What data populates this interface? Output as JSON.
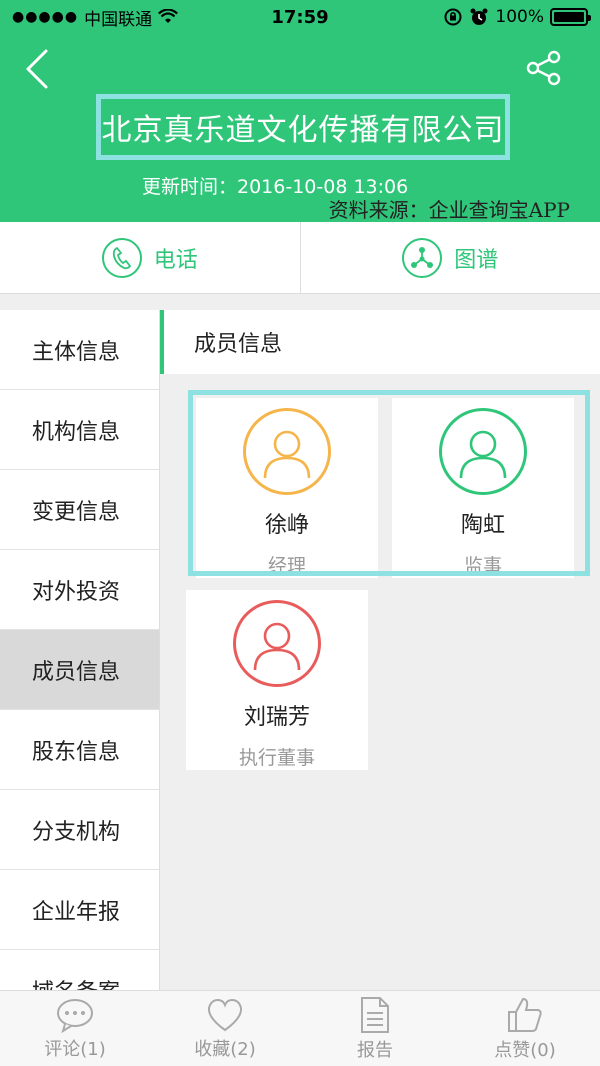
{
  "status_bar": {
    "carrier": "中国联通",
    "time": "17:59",
    "battery": "100%",
    "signal_dots": "●●●●●"
  },
  "header": {
    "company_name": "北京真乐道文化传播有限公司",
    "updated": "更新时间：2016-10-08 13:06",
    "source": "资料来源：企业查询宝APP"
  },
  "actions": [
    {
      "label": "电话",
      "icon": "phone-icon"
    },
    {
      "label": "图谱",
      "icon": "graph-icon"
    }
  ],
  "sidebar": {
    "items": [
      {
        "label": "主体信息"
      },
      {
        "label": "机构信息"
      },
      {
        "label": "变更信息"
      },
      {
        "label": "对外投资"
      },
      {
        "label": "成员信息",
        "active": true
      },
      {
        "label": "股东信息"
      },
      {
        "label": "分支机构"
      },
      {
        "label": "企业年报"
      },
      {
        "label": "域名备案"
      }
    ]
  },
  "content": {
    "section_title": "成员信息",
    "members": [
      {
        "name": "徐峥",
        "role": "经理",
        "color": "#f5b54a"
      },
      {
        "name": "陶虹",
        "role": "监事",
        "color": "#2fc67a"
      },
      {
        "name": "刘瑞芳",
        "role": "执行董事",
        "color": "#e85c5c"
      }
    ]
  },
  "tabbar": {
    "items": [
      {
        "label": "评论(1)",
        "icon": "comment-icon"
      },
      {
        "label": "收藏(2)",
        "icon": "heart-icon"
      },
      {
        "label": "报告",
        "icon": "report-icon"
      },
      {
        "label": "点赞(0)",
        "icon": "thumbs-up-icon"
      }
    ]
  },
  "colors": {
    "brand_green": "#2fc67a",
    "highlight_cyan": "#8de2e1"
  }
}
